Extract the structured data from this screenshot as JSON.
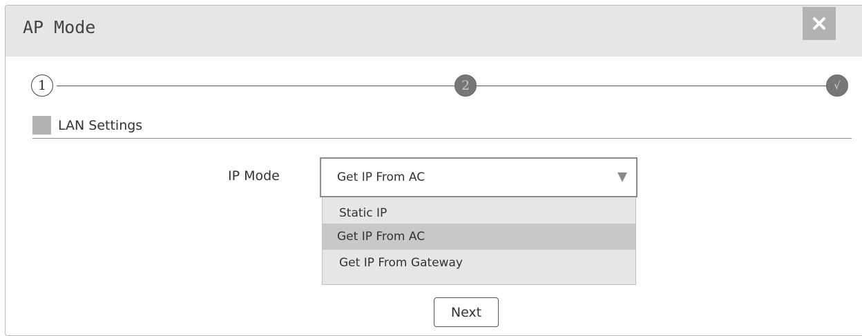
{
  "dialog": {
    "title": "AP Mode",
    "close_icon": "close-icon"
  },
  "steps": {
    "items": [
      {
        "label": "1",
        "state": "active"
      },
      {
        "label": "2",
        "state": "pending"
      },
      {
        "label": "√",
        "state": "pending"
      }
    ]
  },
  "section": {
    "title": "LAN Settings"
  },
  "form": {
    "ip_mode_label": "IP Mode",
    "ip_mode_value": "Get IP From AC",
    "caret_icon": "chevron-down-icon",
    "options": [
      {
        "label": "Static IP",
        "highlighted": false
      },
      {
        "label": "Get IP From AC",
        "highlighted": true
      },
      {
        "label": "Get IP From Gateway",
        "highlighted": false
      }
    ]
  },
  "actions": {
    "next_label": "Next"
  },
  "colors": {
    "header_bg": "#e6e6e6",
    "close_bg": "#b2b2b2",
    "step_pending": "#777777",
    "option_highlight": "#c8c8c8",
    "dropdown_bg": "#e6e6e6"
  }
}
